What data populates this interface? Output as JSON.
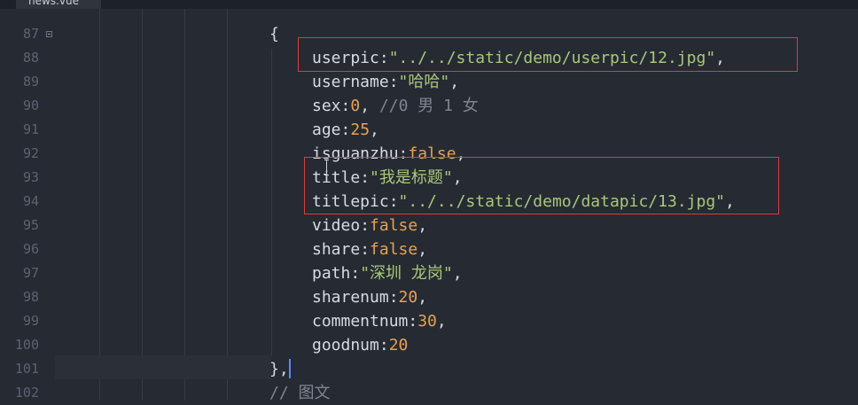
{
  "tab": {
    "label": "news.vue"
  },
  "lines": [
    {
      "num": "87"
    },
    {
      "num": "88"
    },
    {
      "num": "89"
    },
    {
      "num": "90"
    },
    {
      "num": "91"
    },
    {
      "num": "92"
    },
    {
      "num": "93"
    },
    {
      "num": "94"
    },
    {
      "num": "95"
    },
    {
      "num": "96"
    },
    {
      "num": "97"
    },
    {
      "num": "98"
    },
    {
      "num": "99"
    },
    {
      "num": "100"
    },
    {
      "num": "101"
    },
    {
      "num": "102"
    }
  ],
  "code": {
    "open_brace": "{",
    "close_brace": "},",
    "userpic_key": "userpic",
    "userpic_val": "\"../../static/demo/userpic/12.jpg\"",
    "username_key": "username",
    "username_val": "\"哈哈\"",
    "sex_key": "sex",
    "sex_val": "0",
    "sex_comment": "//0 男 1 女",
    "age_key": "age",
    "age_val": "25",
    "isguanzhu_key": "isguanzhu",
    "isguanzhu_val": "false",
    "title_key": "title",
    "title_val": "\"我是标题\"",
    "titlepic_key": "titlepic",
    "titlepic_val": "\"../../static/demo/datapic/13.jpg\"",
    "video_key": "video",
    "video_val": "false",
    "share_key": "share",
    "share_val": "false",
    "path_key": "path",
    "path_val": "\"深圳 龙岗\"",
    "sharenum_key": "sharenum",
    "sharenum_val": "20",
    "commentnum_key": "commentnum",
    "commentnum_val": "30",
    "goodnum_key": "goodnum",
    "goodnum_val": "20",
    "next_comment": "// 图文"
  },
  "colors": {
    "background": "#262b33",
    "string": "#a9c77a",
    "number": "#e5a255",
    "comment": "#7f848e",
    "annotation_box": "#e0393e"
  }
}
